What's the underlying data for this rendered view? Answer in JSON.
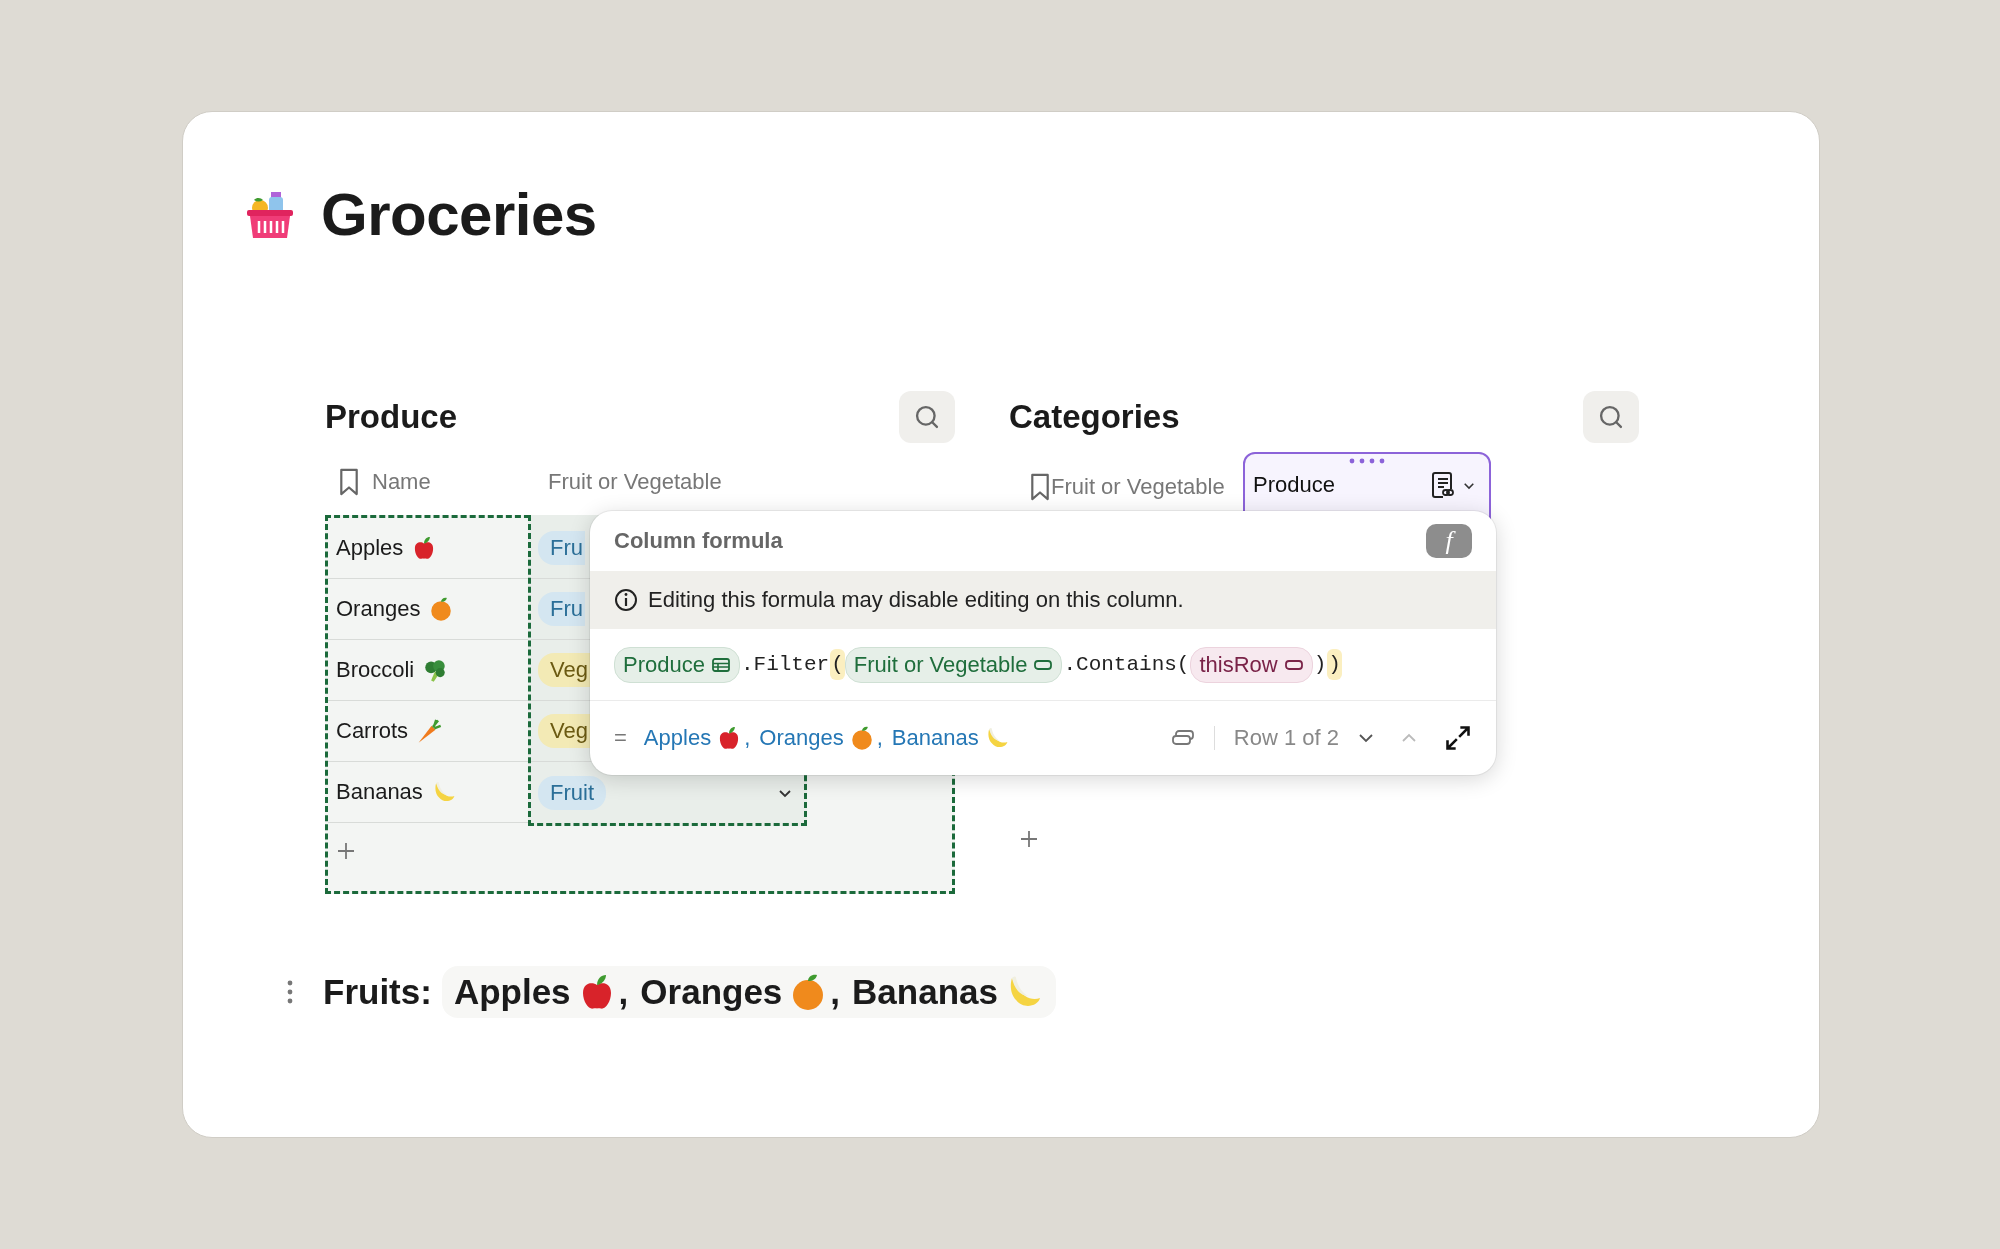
{
  "page": {
    "title": "Groceries"
  },
  "produce": {
    "title": "Produce",
    "columns": [
      {
        "label": "Name",
        "bookmark": true
      },
      {
        "label": "Fruit or Vegetable",
        "bookmark": false
      }
    ],
    "rows": [
      {
        "name": "Apples",
        "kind": "apple",
        "category": {
          "text": "Fru",
          "kind": "fruit",
          "dropdown": false
        }
      },
      {
        "name": "Oranges",
        "kind": "orange",
        "category": {
          "text": "Fru",
          "kind": "fruit",
          "dropdown": false
        }
      },
      {
        "name": "Broccoli",
        "kind": "broccoli",
        "category": {
          "text": "Veg",
          "kind": "vegetable",
          "dropdown": false
        }
      },
      {
        "name": "Carrots",
        "kind": "carrot",
        "category": {
          "text": "Veg",
          "kind": "vegetable",
          "dropdown": false
        }
      },
      {
        "name": "Bananas",
        "kind": "banana",
        "category": {
          "text": "Fruit",
          "kind": "fruit",
          "dropdown": true
        }
      }
    ]
  },
  "categories": {
    "title": "Categories",
    "columns": [
      {
        "label": "Fruit or Vegetable",
        "bookmark": true,
        "selected": false
      },
      {
        "label": "Produce",
        "bookmark": false,
        "selected": true
      }
    ]
  },
  "formula_popup": {
    "title": "Column formula",
    "badge": "f",
    "warning": "Editing this formula may disable editing on this column.",
    "tokens": [
      {
        "kind": "table",
        "text": "Produce"
      },
      {
        "kind": "code",
        "text": ".Filter"
      },
      {
        "kind": "paren",
        "text": "("
      },
      {
        "kind": "column",
        "text": "Fruit or Vegetable"
      },
      {
        "kind": "code",
        "text": ".Contains("
      },
      {
        "kind": "row",
        "text": "thisRow"
      },
      {
        "kind": "code",
        "text": ")"
      },
      {
        "kind": "paren",
        "text": ")"
      }
    ],
    "result_prefix": "=",
    "result": [
      {
        "text": "Apples",
        "kind": "apple",
        "sep": ","
      },
      {
        "text": "Oranges",
        "kind": "orange",
        "sep": ","
      },
      {
        "text": "Bananas",
        "kind": "banana"
      }
    ],
    "row_counter": "Row 1 of 2",
    "next": {
      "disabled": false
    },
    "previous": {
      "disabled": true
    }
  },
  "summary": {
    "label": "Fruits:",
    "items": [
      {
        "text": "Apples",
        "kind": "apple",
        "sep": ","
      },
      {
        "text": "Oranges",
        "kind": "orange",
        "sep": ","
      },
      {
        "text": "Bananas",
        "kind": "banana"
      }
    ]
  }
}
